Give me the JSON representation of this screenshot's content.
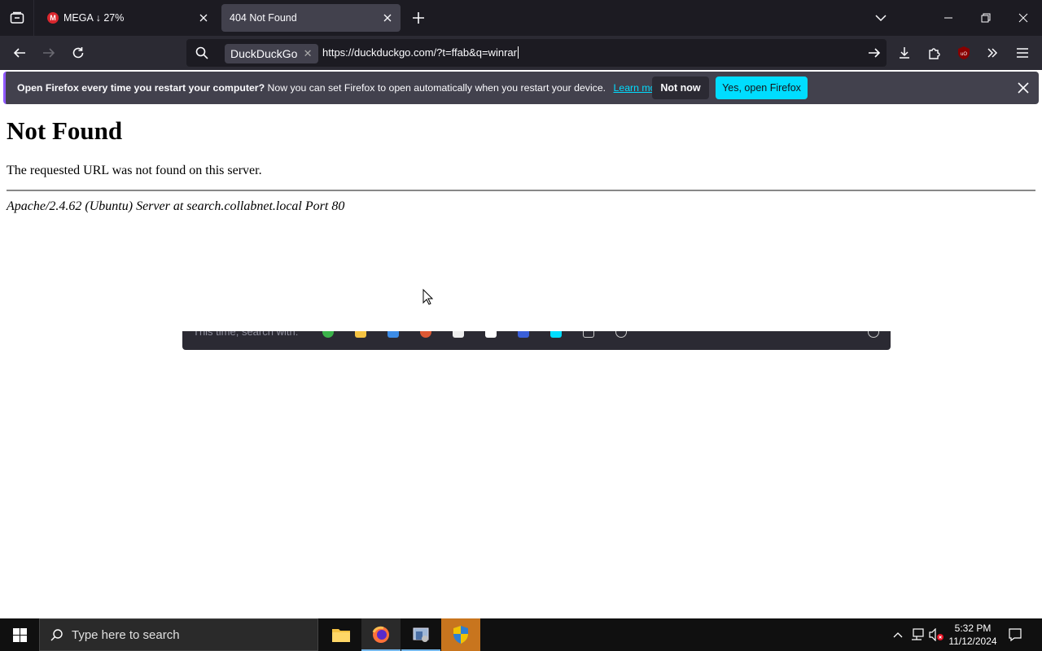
{
  "tabs": [
    {
      "title": "MEGA ↓ 27%",
      "favicon": "M",
      "active": false
    },
    {
      "title": "404 Not Found",
      "active": true
    }
  ],
  "urlbar": {
    "engine": "DuckDuckGo",
    "url": "https://duckduckgo.com/?t=ffab&q=winrar"
  },
  "notification": {
    "bold": "Open Firefox every time you restart your computer?",
    "text": "Now you can set Firefox to open automatically when you restart your device.",
    "link": "Learn more",
    "btn_not_now": "Not now",
    "btn_yes": "Yes, open Firefox"
  },
  "page": {
    "heading": "Not Found",
    "message": "The requested URL was not found on this server.",
    "address": "Apache/2.4.62 (Ubuntu) Server at search.collabnet.local Port 80"
  },
  "search_shortcuts": {
    "label": "This time, search with:"
  },
  "taskbar": {
    "search_placeholder": "Type here to search",
    "time": "5:32 PM",
    "date": "11/12/2024"
  },
  "colors": {
    "accent_cyan": "#00ddff",
    "tab_active": "#42414d",
    "chrome_dark": "#1c1b22",
    "mega_red": "#d9272e"
  }
}
